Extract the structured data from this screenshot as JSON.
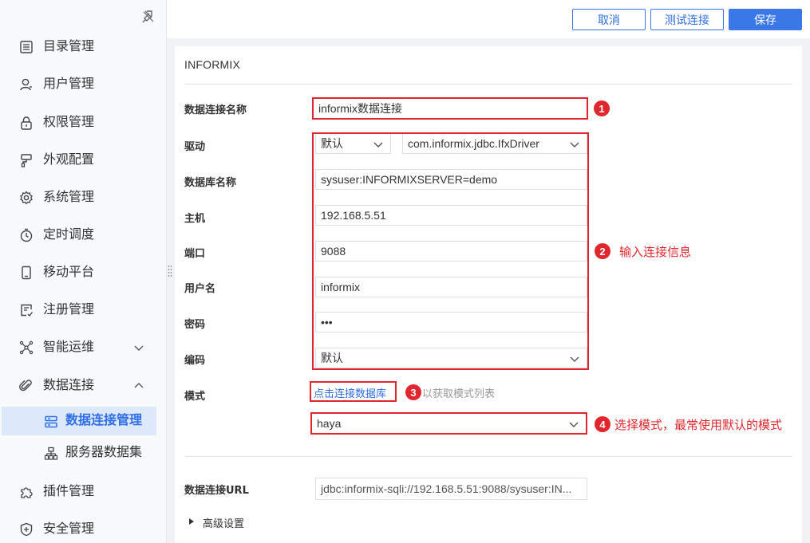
{
  "sidebar": {
    "items": [
      {
        "label": "目录管理"
      },
      {
        "label": "用户管理"
      },
      {
        "label": "权限管理"
      },
      {
        "label": "外观配置"
      },
      {
        "label": "系统管理"
      },
      {
        "label": "定时调度"
      },
      {
        "label": "移动平台"
      },
      {
        "label": "注册管理"
      },
      {
        "label": "智能运维"
      },
      {
        "label": "数据连接"
      },
      {
        "label": "插件管理"
      },
      {
        "label": "安全管理"
      }
    ],
    "sub_items": [
      {
        "label": "数据连接管理"
      },
      {
        "label": "服务器数据集"
      }
    ]
  },
  "toolbar": {
    "cancel_label": "取消",
    "test_label": "测试连接",
    "save_label": "保存"
  },
  "form": {
    "db_type": "INFORMIX",
    "labels": {
      "name": "数据连接名称",
      "driver": "驱动",
      "db_name": "数据库名称",
      "host": "主机",
      "port": "端口",
      "user": "用户名",
      "password": "密码",
      "encoding": "编码",
      "schema": "模式",
      "url": "数据连接URL",
      "advanced": "高级设置"
    },
    "values": {
      "name": "informix数据连接",
      "driver_mode": "默认",
      "driver_class": "com.informix.jdbc.IfxDriver",
      "db_name": "sysuser:INFORMIXSERVER=demo",
      "host": "192.168.5.51",
      "port": "9088",
      "user": "informix",
      "password": "•••",
      "encoding": "默认",
      "schema": "haya",
      "url": "jdbc:informix-sqli://192.168.5.51:9088/sysuser:IN..."
    },
    "schema_link": "点击连接数据库",
    "schema_hint": "以获取模式列表"
  },
  "annotations": {
    "badge1": "1",
    "badge2": "2",
    "badge3": "3",
    "badge4": "4",
    "text2": "输入连接信息",
    "text4": "选择模式，最常使用默认的模式"
  },
  "colors": {
    "accent": "#3a78e8",
    "annotation_red": "#e0272d",
    "active_bg": "#dde9fb"
  },
  "icons": [
    "pin-icon",
    "catalog-icon",
    "user-icon",
    "lock-icon",
    "brush-icon",
    "gear-icon",
    "clock-icon",
    "mobile-icon",
    "register-icon",
    "ops-icon",
    "link-icon",
    "db-icon",
    "server-dataset-icon",
    "plugin-icon",
    "shield-icon",
    "chevron-down-icon",
    "chevron-up-icon",
    "caret-right-icon"
  ]
}
